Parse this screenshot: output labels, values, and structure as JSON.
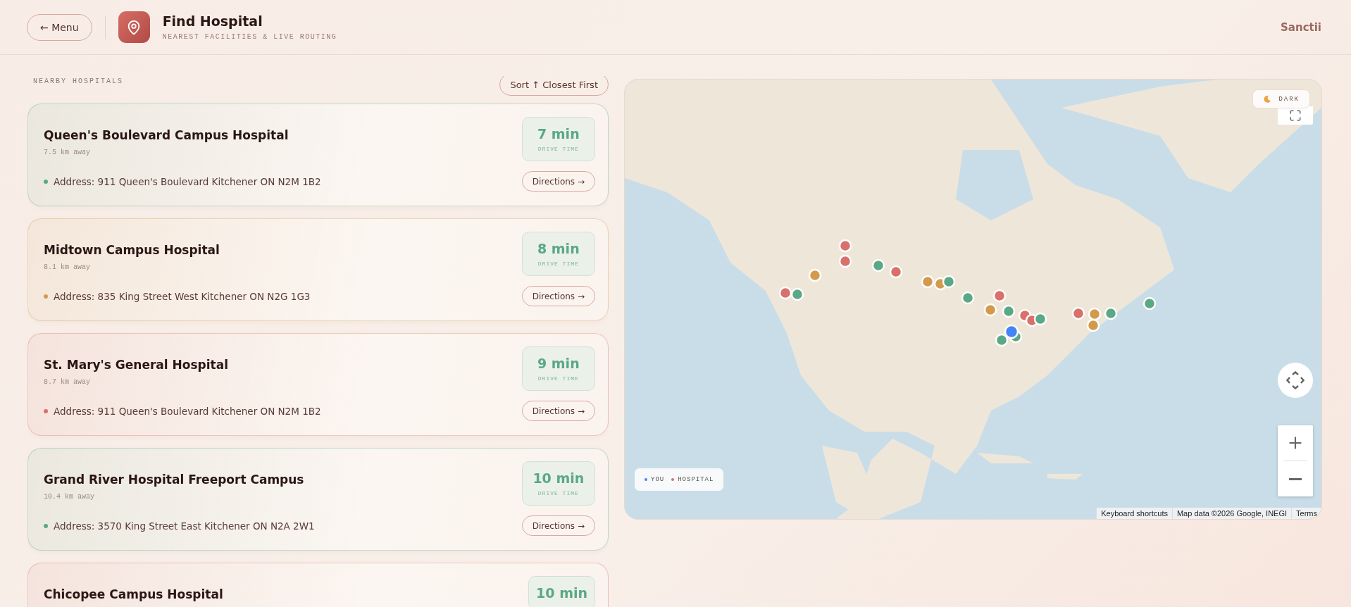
{
  "header": {
    "back_button": "← Menu",
    "title": "Find Hospital",
    "subtitle": "NEAREST FACILITIES & LIVE ROUTING",
    "brand": "Sanctii"
  },
  "list": {
    "heading": "NEARBY HOSPITALS",
    "sort_button": "Sort ↑ Closest First",
    "hospitals": [
      {
        "name": "Queen's Boulevard Campus Hospital",
        "distance": "7.5 km away",
        "address": "Address: 911 Queen's Boulevard Kitchener ON N2M 1B2",
        "color": "#5aa886",
        "time": "7 min",
        "time_label": "DRIVE TIME",
        "action": "Directions →"
      },
      {
        "name": "Midtown Campus Hospital",
        "distance": "8.1 km away",
        "address": "Address: 835 King Street West Kitchener ON N2G 1G3",
        "color": "#d49a4c",
        "time": "8 min",
        "time_label": "DRIVE TIME",
        "action": "Directions →"
      },
      {
        "name": "St. Mary's General Hospital",
        "distance": "8.7 km away",
        "address": "Address: 911 Queen's Boulevard Kitchener ON N2M 1B2",
        "color": "#d9706b",
        "time": "9 min",
        "time_label": "DRIVE TIME",
        "action": "Directions →"
      },
      {
        "name": "Grand River Hospital Freeport Campus",
        "distance": "10.4 km away",
        "address": "Address: 3570 King Street East Kitchener ON N2A 2W1",
        "color": "#5aa886",
        "time": "10 min",
        "time_label": "DRIVE TIME",
        "action": "Directions →"
      },
      {
        "name": "Chicopee Campus Hospital",
        "time": "10 min"
      }
    ]
  },
  "map": {
    "kind": "picture",
    "theme_button": "DARK",
    "legend": [
      {
        "label": "YOU",
        "color": "#4285f4"
      },
      {
        "label": "HOSPITAL",
        "color": "#d9706b"
      }
    ],
    "attribution": [
      "Keyboard shortcuts",
      "Map data ©2026 Google, INEGI",
      "Terms"
    ]
  }
}
